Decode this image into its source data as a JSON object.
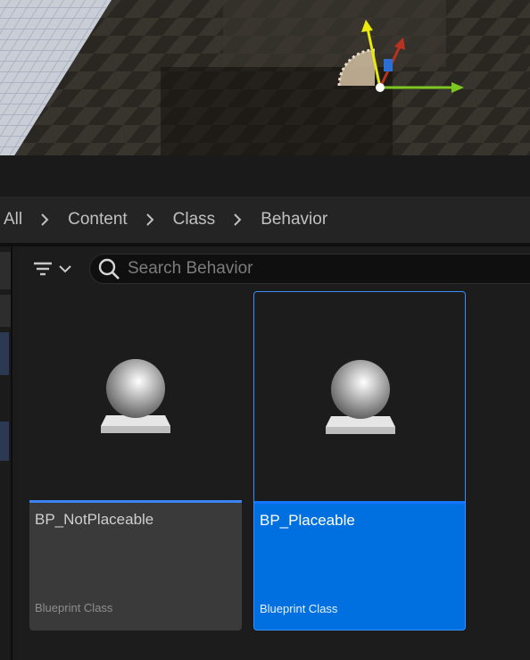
{
  "breadcrumb": {
    "items": [
      "All",
      "Content",
      "Class",
      "Behavior"
    ]
  },
  "toolbar": {
    "filter_icon": "filter-icon",
    "search_icon": "search-icon",
    "search_placeholder": "Search Behavior",
    "search_value": ""
  },
  "assets": [
    {
      "name": "BP_NotPlaceable",
      "type": "Blueprint Class",
      "icon": "sphere-actor-icon",
      "selected": false
    },
    {
      "name": "BP_Placeable",
      "type": "Blueprint Class",
      "icon": "sphere-actor-icon",
      "selected": true
    }
  ],
  "colors": {
    "accent": "#0070e0",
    "thumb_bar": "#3b82f6",
    "panel": "#1c1c1c"
  }
}
